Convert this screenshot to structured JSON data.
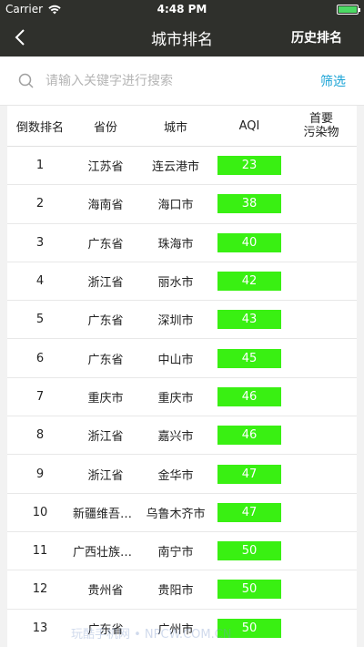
{
  "status": {
    "carrier": "Carrier",
    "time": "4:48 PM",
    "battery_level": 1.0
  },
  "nav": {
    "back_icon": "chevron-left-icon",
    "title": "城市排名",
    "right": "历史排名"
  },
  "search": {
    "placeholder": "请输入关键字进行搜索",
    "filter": "筛选"
  },
  "table": {
    "headers": {
      "rank": "倒数排名",
      "province": "省份",
      "city": "城市",
      "aqi": "AQI",
      "pollutant": "首要\n污染物"
    },
    "rows": [
      {
        "rank": "1",
        "province": "江苏省",
        "city": "连云港市",
        "aqi": "23",
        "pollutant": ""
      },
      {
        "rank": "2",
        "province": "海南省",
        "city": "海口市",
        "aqi": "38",
        "pollutant": ""
      },
      {
        "rank": "3",
        "province": "广东省",
        "city": "珠海市",
        "aqi": "40",
        "pollutant": ""
      },
      {
        "rank": "4",
        "province": "浙江省",
        "city": "丽水市",
        "aqi": "42",
        "pollutant": ""
      },
      {
        "rank": "5",
        "province": "广东省",
        "city": "深圳市",
        "aqi": "43",
        "pollutant": ""
      },
      {
        "rank": "6",
        "province": "广东省",
        "city": "中山市",
        "aqi": "45",
        "pollutant": ""
      },
      {
        "rank": "7",
        "province": "重庆市",
        "city": "重庆市",
        "aqi": "46",
        "pollutant": ""
      },
      {
        "rank": "8",
        "province": "浙江省",
        "city": "嘉兴市",
        "aqi": "46",
        "pollutant": ""
      },
      {
        "rank": "9",
        "province": "浙江省",
        "city": "金华市",
        "aqi": "47",
        "pollutant": ""
      },
      {
        "rank": "10",
        "province": "新疆维吾尔...",
        "city": "乌鲁木齐市",
        "aqi": "47",
        "pollutant": ""
      },
      {
        "rank": "11",
        "province": "广西壮族自...",
        "city": "南宁市",
        "aqi": "50",
        "pollutant": ""
      },
      {
        "rank": "12",
        "province": "贵州省",
        "city": "贵阳市",
        "aqi": "50",
        "pollutant": ""
      },
      {
        "rank": "13",
        "province": "广东省",
        "city": "广州市",
        "aqi": "50",
        "pollutant": ""
      }
    ]
  },
  "watermark": "玩酷手机网 • NPCW.COM.CN",
  "colors": {
    "bar": "#2f302c",
    "aqi_good": "#39f012",
    "link": "#19a3d6"
  }
}
